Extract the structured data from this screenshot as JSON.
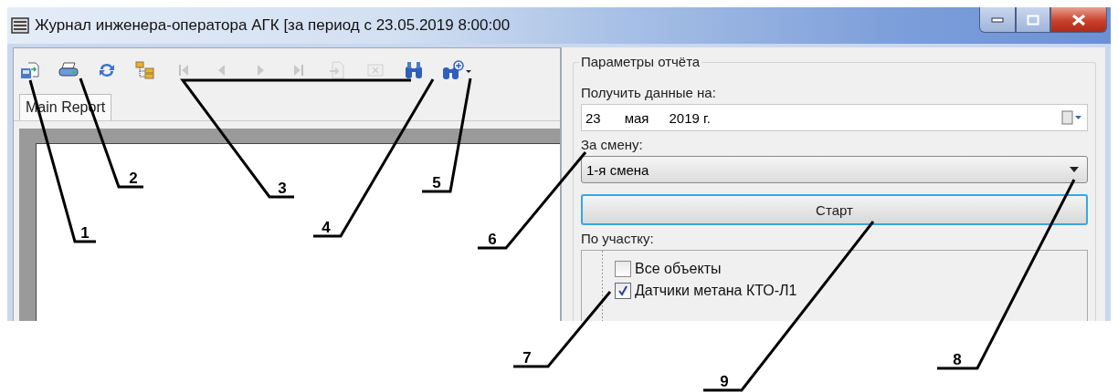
{
  "window": {
    "title": "Журнал инженера-оператора АГК [за период с 23.05.2019 8:00:00"
  },
  "toolbar": [
    {
      "kind": "export",
      "disabled": false
    },
    {
      "kind": "print",
      "disabled": false
    },
    {
      "kind": "refresh",
      "disabled": false
    },
    {
      "kind": "tree",
      "disabled": false
    },
    {
      "kind": "first",
      "disabled": true
    },
    {
      "kind": "prev",
      "disabled": true
    },
    {
      "kind": "next",
      "disabled": true
    },
    {
      "kind": "last",
      "disabled": true
    },
    {
      "kind": "goto",
      "disabled": true
    },
    {
      "kind": "stop",
      "disabled": true
    },
    {
      "kind": "search",
      "disabled": false
    },
    {
      "kind": "search-options",
      "disabled": false
    }
  ],
  "tabs": [
    {
      "label": "Main Report",
      "selected": true
    }
  ],
  "parameters": {
    "title": "Параметры отчёта",
    "date_label": "Получить данные на:",
    "date": {
      "day": "23",
      "month": "мая",
      "year": "2019 г."
    },
    "shift_label": "За смену:",
    "shift": "1-я смена",
    "start_button": "Старт",
    "area_label": "По участку:",
    "areas": [
      {
        "label": "Все объекты",
        "checked": false
      },
      {
        "label": "Датчики метана КТО-Л1",
        "checked": true
      }
    ]
  },
  "callouts": [
    {
      "label": "1"
    },
    {
      "label": "2"
    },
    {
      "label": "3"
    },
    {
      "label": "4"
    },
    {
      "label": "5"
    },
    {
      "label": "6"
    },
    {
      "label": "7"
    },
    {
      "label": "8"
    },
    {
      "label": "9"
    }
  ]
}
